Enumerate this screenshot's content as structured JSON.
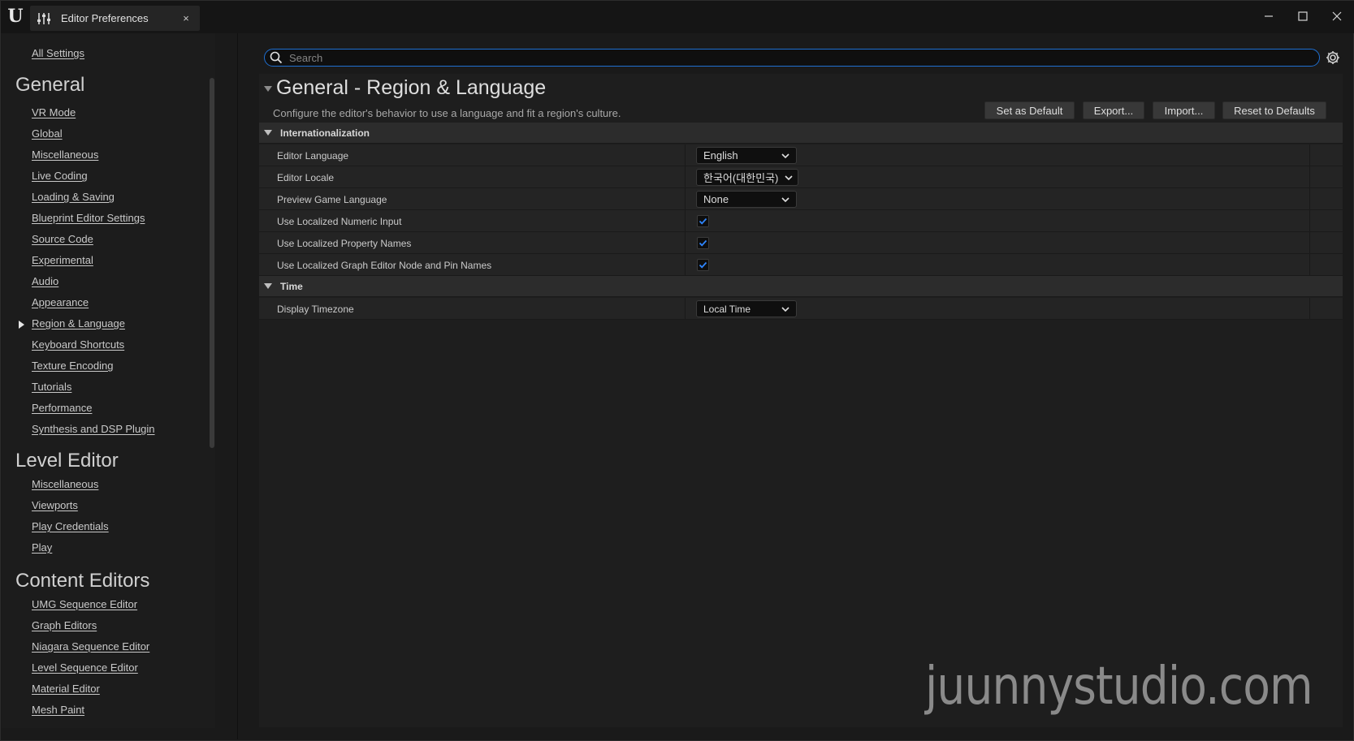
{
  "window": {
    "tab_title": "Editor Preferences",
    "tab_close": "×"
  },
  "sidebar": {
    "all_settings": "All Settings",
    "sections": [
      {
        "title": "General",
        "items": [
          "VR Mode",
          "Global",
          "Miscellaneous",
          "Live Coding",
          "Loading & Saving",
          "Blueprint Editor Settings",
          "Source Code",
          "Experimental",
          "Audio",
          "Appearance",
          "Region & Language",
          "Keyboard Shortcuts",
          "Texture Encoding",
          "Tutorials",
          "Performance",
          "Synthesis and DSP Plugin"
        ]
      },
      {
        "title": "Level Editor",
        "items": [
          "Miscellaneous",
          "Viewports",
          "Play Credentials",
          "Play"
        ]
      },
      {
        "title": "Content Editors",
        "items": [
          "UMG Sequence Editor",
          "Graph Editors",
          "Niagara Sequence Editor",
          "Level Sequence Editor",
          "Material Editor",
          "Mesh Paint"
        ]
      }
    ],
    "active_item": "Region & Language"
  },
  "search": {
    "placeholder": "Search"
  },
  "main": {
    "title": "General - Region & Language",
    "description": "Configure the editor's behavior to use a language and fit a region's culture.",
    "buttons": {
      "set_default": "Set as Default",
      "export": "Export...",
      "import": "Import...",
      "reset": "Reset to Defaults"
    },
    "categories": [
      {
        "name": "Internationalization",
        "properties": [
          {
            "name": "Editor Language",
            "type": "combo",
            "value": "English"
          },
          {
            "name": "Editor Locale",
            "type": "combo",
            "value": "한국어(대한민국)"
          },
          {
            "name": "Preview Game Language",
            "type": "combo",
            "value": "None"
          },
          {
            "name": "Use Localized Numeric Input",
            "type": "checkbox",
            "checked": true
          },
          {
            "name": "Use Localized Property Names",
            "type": "checkbox",
            "checked": true
          },
          {
            "name": "Use Localized Graph Editor Node and Pin Names",
            "type": "checkbox",
            "checked": true
          }
        ]
      },
      {
        "name": "Time",
        "properties": [
          {
            "name": "Display Timezone",
            "type": "combo",
            "value": "Local Time"
          }
        ]
      }
    ]
  },
  "watermark": "juunnystudio.com",
  "colors": {
    "accent": "#1f6fd1",
    "checkmark": "#2f86ff",
    "background": "#1a1a1a"
  }
}
